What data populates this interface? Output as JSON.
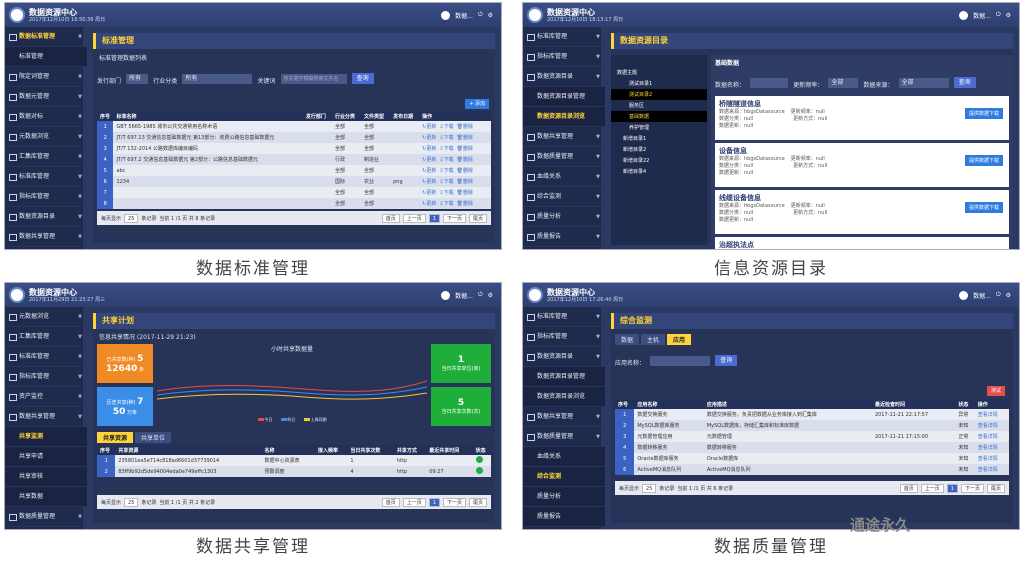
{
  "app": {
    "title": "数据资源中心",
    "user": "数据..."
  },
  "panes": {
    "standard": {
      "time": "2017年12月10日 16:50:36 周日",
      "nav": [
        "数据标准管理",
        "标准管理",
        "限定词管理",
        "数据元管理",
        "数据对标",
        "元数据浏览",
        "汇集库管理",
        "标准库管理",
        "指标库管理",
        "数据资源目录",
        "数据共享管理",
        "数据质量管理"
      ],
      "header": "标准管理",
      "list_title": "标准管理数据列表",
      "filters": {
        "dept_label": "发行部门",
        "dept_value": "所有",
        "cat_label": "行业分类",
        "cat_value": "所有",
        "kw_label": "关键词",
        "kw_placeholder": "按关键字模糊搜索文件名",
        "query": "查询",
        "add": "+ 添加"
      },
      "columns": [
        "序号",
        "标准名称",
        "发行部门",
        "行业分类",
        "文件类型",
        "发布日期",
        "操作"
      ],
      "rows": [
        [
          "1",
          "GBT 5665-1985 城市公共交通常用名称术语",
          "",
          "全部",
          "全部",
          ""
        ],
        [
          "2",
          "JT/T 697.13 交通信息基础数据元 第13部分：收费公路信息基础数据元",
          "",
          "全部",
          "全部",
          ""
        ],
        [
          "3",
          "JT/T 132-2014 公路数据库编目编码",
          "",
          "全部",
          "全部",
          ""
        ],
        [
          "4",
          "JT/T 697.2 交通信息基础数据元 第2部分：公路信息基础数据元",
          "",
          "行政",
          "制造业",
          ""
        ],
        [
          "5",
          "abc",
          "",
          "全部",
          "全部",
          ""
        ],
        [
          "6",
          "1234",
          "",
          "国际",
          "农业",
          "png"
        ],
        [
          "7",
          "",
          "",
          "全部",
          "全部",
          ""
        ],
        [
          "8",
          "",
          "",
          "全部",
          "全部",
          ""
        ]
      ],
      "ops": [
        "更新",
        "下载",
        "删除"
      ],
      "pager": {
        "left": "每页显示",
        "size": "25",
        "unit": "条记录",
        "info": "当前 1 /1 页 共 8 条记录",
        "first": "首页",
        "prev": "上一页",
        "cur": "1",
        "next": "下一页",
        "last": "尾页"
      },
      "caption": "数据标准管理"
    },
    "catalog": {
      "time": "2017年12月10日 18:13:17 周日",
      "nav": [
        "标准库管理",
        "指标库管理",
        "数据资源目录",
        "数据资源目录管理",
        "数据资源目录浏览",
        "数据共享管理",
        "数据质量管理",
        "血缘关系",
        "综合监测",
        "质量分析",
        "质量报告",
        "系统管理"
      ],
      "header": "数据资源目录",
      "tree": [
        "数据主题",
        "测试目录1",
        "测试目录2",
        "服务区",
        "基础数据",
        "养护管理",
        "新增目录1",
        "新增目录2",
        "新增目录22",
        "新增目录4"
      ],
      "detail_title": "基础数据",
      "search": {
        "name_label": "数据名称：",
        "freq_label": "更新频率：",
        "freq_value": "全部",
        "src_label": "数据来源：",
        "src_value": "全部",
        "query": "查询"
      },
      "cards": [
        {
          "title": "桥隧隧道信息",
          "src": "数据来源：hbgsDatasource",
          "rate": "更新频率：null",
          "ctype": "数据分类：null",
          "upd": "数据更新：null",
          "mode": "更新方式：null",
          "btn": "提供数据下载"
        },
        {
          "title": "设备信息",
          "src": "数据来源：hbgsDatasource",
          "rate": "更新频率：null",
          "ctype": "数据分类：null",
          "upd": "数据更新：null",
          "mode": "更新方式：null",
          "btn": "提供数据下载"
        },
        {
          "title": "线缆设备信息",
          "src": "数据来源：hbgsDatasource",
          "rate": "更新频率：null",
          "ctype": "数据分类：null",
          "upd": "数据更新：null",
          "mode": "更新方式：null",
          "btn": "提供数据下载"
        },
        {
          "title": "治超执法点",
          "src": "",
          "rate": "",
          "ctype": "",
          "upd": "",
          "mode": "",
          "btn": "提供数据下载"
        }
      ],
      "caption": "信息资源目录"
    },
    "share": {
      "time": "2017年11月29日 21:23:27 周三",
      "nav": [
        "元数据浏览",
        "汇集库管理",
        "标准库管理",
        "指标库管理",
        "资产监控",
        "数据共享管理",
        "共享监测",
        "共享申请",
        "共享审核",
        "共享数据",
        "数据质量管理",
        "系统管理",
        "数据管理"
      ],
      "header": "共享计划",
      "sub_title": "信息共享情况 (2017-11-29 21:23)",
      "kpi1": {
        "label": "已共享数(种)",
        "v1": "5",
        "v2": "12640",
        "u": "条"
      },
      "kpi2": {
        "label": "历史共享(种)",
        "v1": "7",
        "v2": "50",
        "u": "万条"
      },
      "chart_title": "小时共享数据量",
      "right1": {
        "v": "1",
        "label": "当日共享单位(家)"
      },
      "right2": {
        "v": "5",
        "label": "当日共享次数(次)"
      },
      "legend": [
        "今日",
        "昨日",
        "上周同期"
      ],
      "tabs": [
        "共享资源",
        "共享单位"
      ],
      "columns": [
        "序号",
        "共享资源",
        "名称",
        "接入频率",
        "当日共享次数",
        "共享方式",
        "最近共享时间",
        "状态"
      ],
      "rows": [
        [
          "1",
          "235801ea5e714c818ad6601d37739014",
          "数据中心资源表",
          "",
          "1",
          "http",
          ""
        ],
        [
          "2",
          "83ff9b92d5de94004eda0e749effc1303",
          "预警调度",
          "",
          "4",
          "http",
          "09:27"
        ]
      ],
      "pager": {
        "left": "每页显示",
        "size": "25",
        "unit": "条记录",
        "info": "当前 1 /1 页 共 2 条记录",
        "first": "首页",
        "prev": "上一页",
        "cur": "1",
        "next": "下一页",
        "last": "尾页"
      },
      "caption": "数据共享管理"
    },
    "quality": {
      "time": "2017年12月10日 17:26:40 周日",
      "nav": [
        "标准库管理",
        "指标库管理",
        "数据资源目录",
        "数据资源目录管理",
        "数据资源目录浏览",
        "数据共享管理",
        "数据质量管理",
        "血缘关系",
        "综合监测",
        "质量分析",
        "质量报告",
        "系统管理"
      ],
      "header": "综合监测",
      "tabs": [
        "数据",
        "主机",
        "应用"
      ],
      "app_label": "应用名称：",
      "query": "查询",
      "test": "测试",
      "columns": [
        "序号",
        "应用名称",
        "应用描述",
        "最近检查时间",
        "状态",
        "操作"
      ],
      "rows": [
        [
          "1",
          "数据交换服务",
          "数据交换服务，负责把数据从业务库接入到汇集库",
          "2017-11-21 22:17:57",
          "异常",
          "查看详情"
        ],
        [
          "2",
          "MySQL数据库服务",
          "MySQL数据库，存储汇集库和标准库数据",
          "",
          "未知",
          "查看详情"
        ],
        [
          "3",
          "元数据管理应用",
          "元数据管理",
          "2017-11-21 17:15:00",
          "正常",
          "查看详情"
        ],
        [
          "4",
          "数据转移服务",
          "数据转移服务",
          "",
          "未知",
          "查看详情"
        ],
        [
          "5",
          "Oracle数据库服务",
          "Oracle数据库",
          "",
          "未知",
          "查看详情"
        ],
        [
          "6",
          "ActiveMQ消息队列",
          "ActiveMQ消息队列",
          "",
          "未知",
          "查看详情"
        ]
      ],
      "pager": {
        "left": "每页显示",
        "size": "25",
        "unit": "条记录",
        "info": "当前 1 /1 页 共 6 条记录",
        "first": "首页",
        "prev": "上一页",
        "cur": "1",
        "next": "下一页",
        "last": "尾页"
      },
      "caption": "数据质量管理"
    }
  },
  "watermark": "通途永久",
  "colors": {
    "accent": "#ffd43a",
    "header": "#2d3f70",
    "blue": "#3c63c4"
  }
}
